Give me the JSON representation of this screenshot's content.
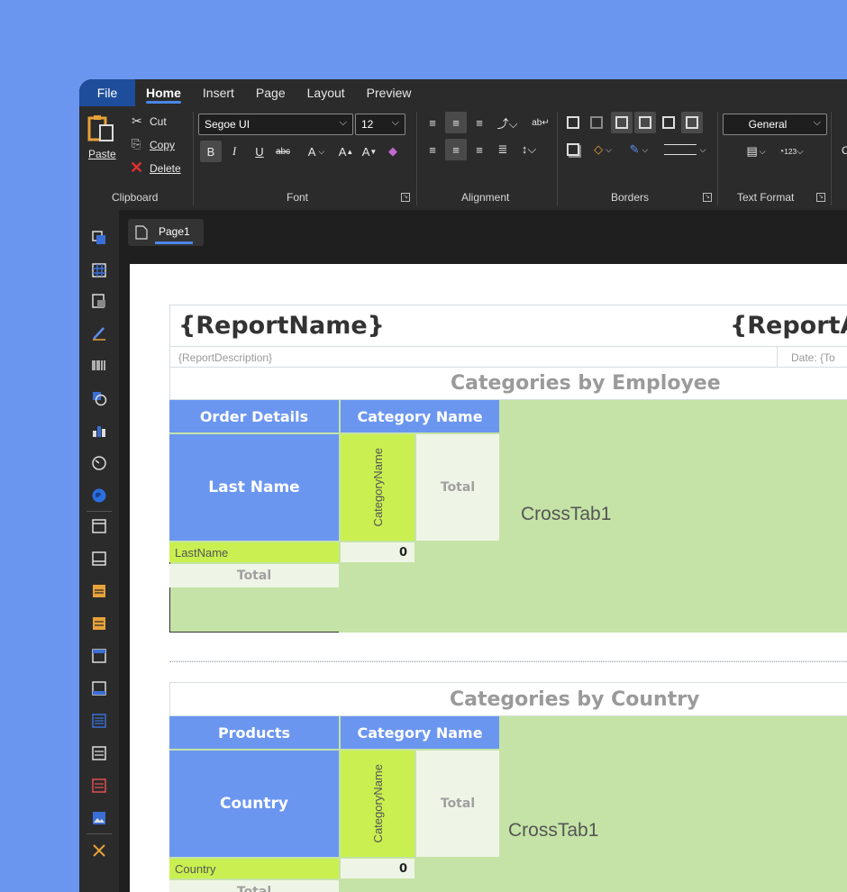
{
  "menu": {
    "file": "File",
    "tabs": [
      {
        "label": "Home"
      },
      {
        "label": "Insert"
      },
      {
        "label": "Page"
      },
      {
        "label": "Layout"
      },
      {
        "label": "Preview"
      }
    ]
  },
  "ribbon": {
    "clipboard": {
      "paste": "Paste",
      "cut": "Cut",
      "copy": "Copy",
      "delete": "Delete",
      "label": "Clipboard"
    },
    "font": {
      "family": "Segoe UI",
      "size": "12",
      "label": "Font"
    },
    "alignment": {
      "label": "Alignment"
    },
    "borders": {
      "label": "Borders"
    },
    "text_format": {
      "value": "General",
      "label": "Text Format"
    },
    "overflow_char": "C"
  },
  "page_tab": {
    "label": "Page1"
  },
  "report": {
    "name": "{ReportName}",
    "name_right": "{ReportA",
    "description": "{ReportDescription}",
    "date": "Date: {To"
  },
  "crosstabs": [
    {
      "section_title": "Categories by Employee",
      "header_left": "Order Details",
      "header_right": "Category Name",
      "row_header": "Last Name",
      "col_field": "CategoryName",
      "col_total": "Total",
      "row_field": "LastName",
      "value": "0",
      "row_total": "Total",
      "name": "CrossTab1"
    },
    {
      "section_title": "Categories by Country",
      "header_left": "Products",
      "header_right": "Category Name",
      "row_header": "Country",
      "col_field": "CategoryName",
      "col_total": "Total",
      "row_field": "Country",
      "value": "0",
      "row_total": "Total",
      "name": "CrossTab1"
    }
  ],
  "colors": {
    "accent": "#4a86e8",
    "header_blue": "#6b96f0",
    "lime": "#c9f050",
    "crosstab_bg": "#c5e3a6"
  }
}
